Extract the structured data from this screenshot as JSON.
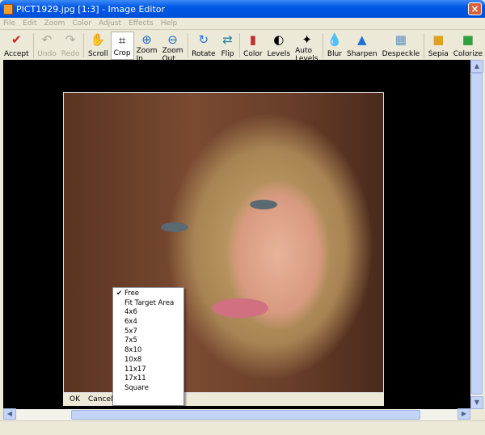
{
  "window": {
    "title": "PICT1929.jpg [1:3] - Image Editor",
    "close": "×"
  },
  "menu": [
    "File",
    "Edit",
    "Zoom",
    "Color",
    "Adjust",
    "Effects",
    "Help"
  ],
  "toolbar": [
    {
      "label": "Accept",
      "icon": "✔",
      "color": "#d02020",
      "name": "accept"
    },
    {
      "sep": true
    },
    {
      "label": "Undo",
      "icon": "↶",
      "disabled": true,
      "name": "undo"
    },
    {
      "label": "Redo",
      "icon": "↷",
      "disabled": true,
      "name": "redo"
    },
    {
      "sep": true
    },
    {
      "label": "Scroll",
      "icon": "✋",
      "name": "scroll"
    },
    {
      "label": "Crop",
      "icon": "⌗",
      "active": true,
      "name": "crop"
    },
    {
      "label": "Zoom In",
      "icon": "⊕",
      "color": "#2070c0",
      "name": "zoom-in"
    },
    {
      "label": "Zoom Out",
      "icon": "⊖",
      "color": "#2070c0",
      "name": "zoom-out"
    },
    {
      "sep": true
    },
    {
      "label": "Rotate",
      "icon": "↻",
      "color": "#3070d0",
      "name": "rotate"
    },
    {
      "label": "Flip",
      "icon": "⇄",
      "color": "#2080a0",
      "name": "flip"
    },
    {
      "sep": true
    },
    {
      "label": "Color",
      "icon": "▮",
      "color": "#c03030",
      "name": "color"
    },
    {
      "label": "Levels",
      "icon": "◐",
      "name": "levels"
    },
    {
      "label": "Auto Levels",
      "icon": "✦",
      "name": "auto-levels"
    },
    {
      "sep": true
    },
    {
      "label": "Blur",
      "icon": "💧",
      "color": "#2070d0",
      "name": "blur"
    },
    {
      "label": "Sharpen",
      "icon": "▲",
      "color": "#2070d0",
      "name": "sharpen"
    },
    {
      "label": "Despeckle",
      "icon": "▦",
      "color": "#6090c0",
      "name": "despeckle"
    },
    {
      "sep": true
    },
    {
      "label": "Sepia",
      "icon": "■",
      "color": "#e0a020",
      "name": "sepia"
    },
    {
      "label": "Colorize",
      "icon": "■",
      "color": "#30a040",
      "name": "colorize"
    }
  ],
  "crop": {
    "ok": "OK",
    "cancel": "Cancel",
    "options": [
      "Free",
      "Fit Target Area",
      "4x6",
      "6x4",
      "5x7",
      "7x5",
      "8x10",
      "10x8",
      "11x17",
      "17x11",
      "Square"
    ],
    "selected": "Free",
    "check": "✔"
  }
}
